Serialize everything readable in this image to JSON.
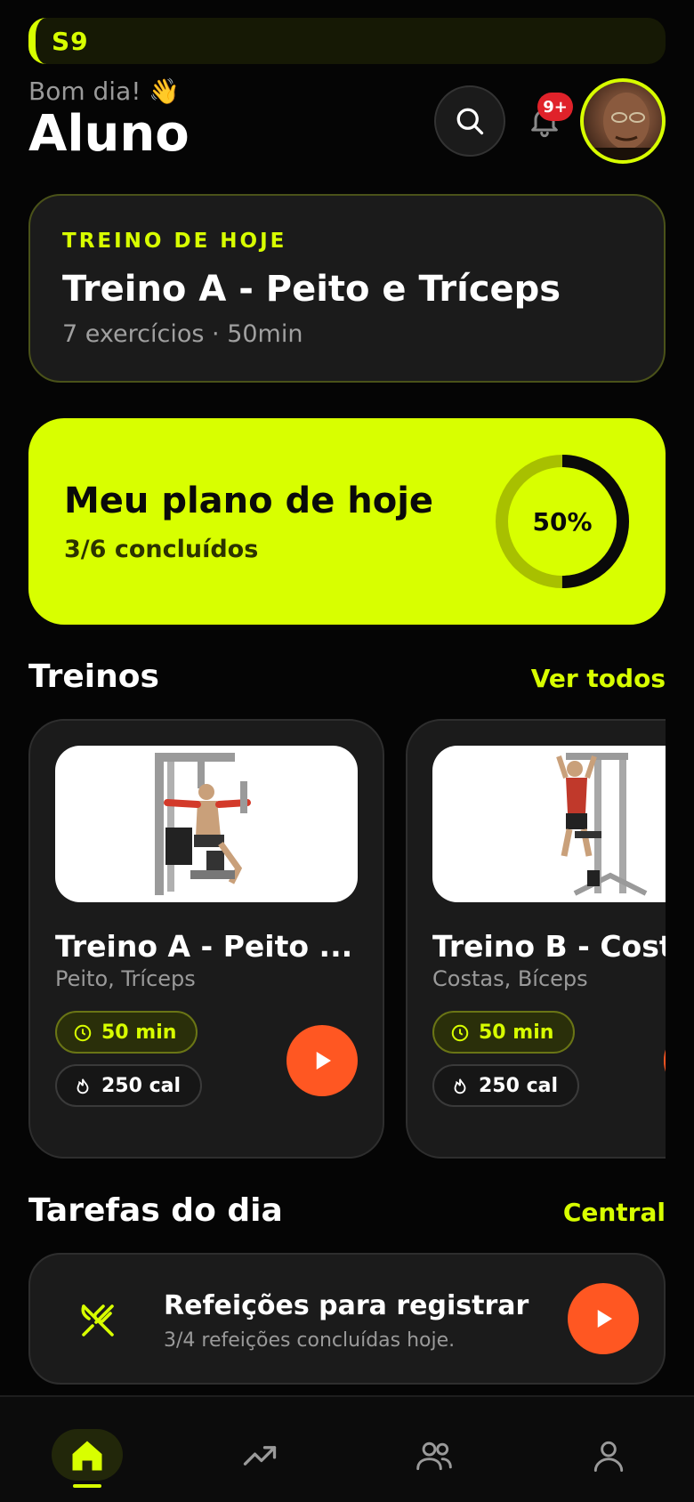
{
  "brand": {
    "name": "S9"
  },
  "header": {
    "greeting": "Bom dia! 👋",
    "user_name": "Aluno",
    "notification_badge": "9+"
  },
  "today_workout": {
    "label": "TREINO DE HOJE",
    "title": "Treino A - Peito e Tríceps",
    "meta": "7 exercícios · 50min"
  },
  "plan": {
    "title": "Meu plano de hoje",
    "subtitle": "3/6 concluídos",
    "percent_label": "50%",
    "progress": 0.5
  },
  "workouts_section": {
    "title": "Treinos",
    "link": "Ver todos",
    "items": [
      {
        "title": "Treino A - Peito ...",
        "tags": "Peito, Tríceps",
        "duration": "50 min",
        "calories": "250 cal"
      },
      {
        "title": "Treino B - Costas e Bíceps",
        "tags": "Costas, Bíceps",
        "duration": "50 min",
        "calories": "250 cal"
      }
    ]
  },
  "tasks_section": {
    "title": "Tarefas do dia",
    "link": "Central",
    "items": [
      {
        "title": "Refeições para registrar",
        "subtitle": "3/4 refeições concluídas hoje."
      }
    ]
  },
  "colors": {
    "accent": "#d8ff00",
    "action": "#ff5722",
    "badge": "#e0222a",
    "card": "#1b1b1b",
    "background": "#050505"
  },
  "icons": {
    "search": "search-icon",
    "bell": "bell-icon",
    "clock": "clock-icon",
    "flame": "flame-icon",
    "play": "play-icon",
    "utensils": "utensils-icon",
    "home": "home-icon",
    "trend": "trending-up-icon",
    "community": "users-icon",
    "profile": "user-icon"
  }
}
